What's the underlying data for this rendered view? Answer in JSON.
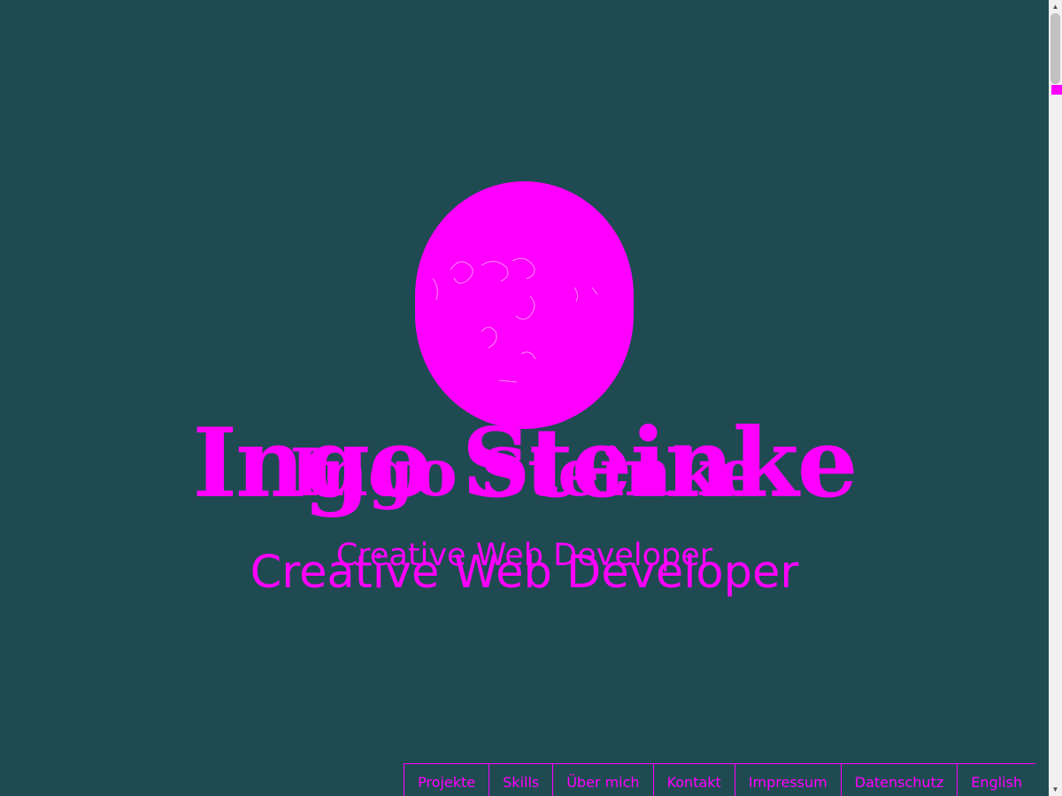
{
  "hero": {
    "name": "Ingo Steinke",
    "tagline": "Creative Web Developer"
  },
  "nav": {
    "items": [
      {
        "label": "Projekte"
      },
      {
        "label": "Skills"
      },
      {
        "label": "Über mich"
      },
      {
        "label": "Kontakt"
      },
      {
        "label": "Impressum"
      },
      {
        "label": "Datenschutz"
      },
      {
        "label": "English"
      }
    ]
  },
  "colors": {
    "background": "#1f4a52",
    "accent": "#ff00ff"
  },
  "icons": {
    "scroll_up": "triangle-up",
    "scroll_down": "triangle-down"
  }
}
